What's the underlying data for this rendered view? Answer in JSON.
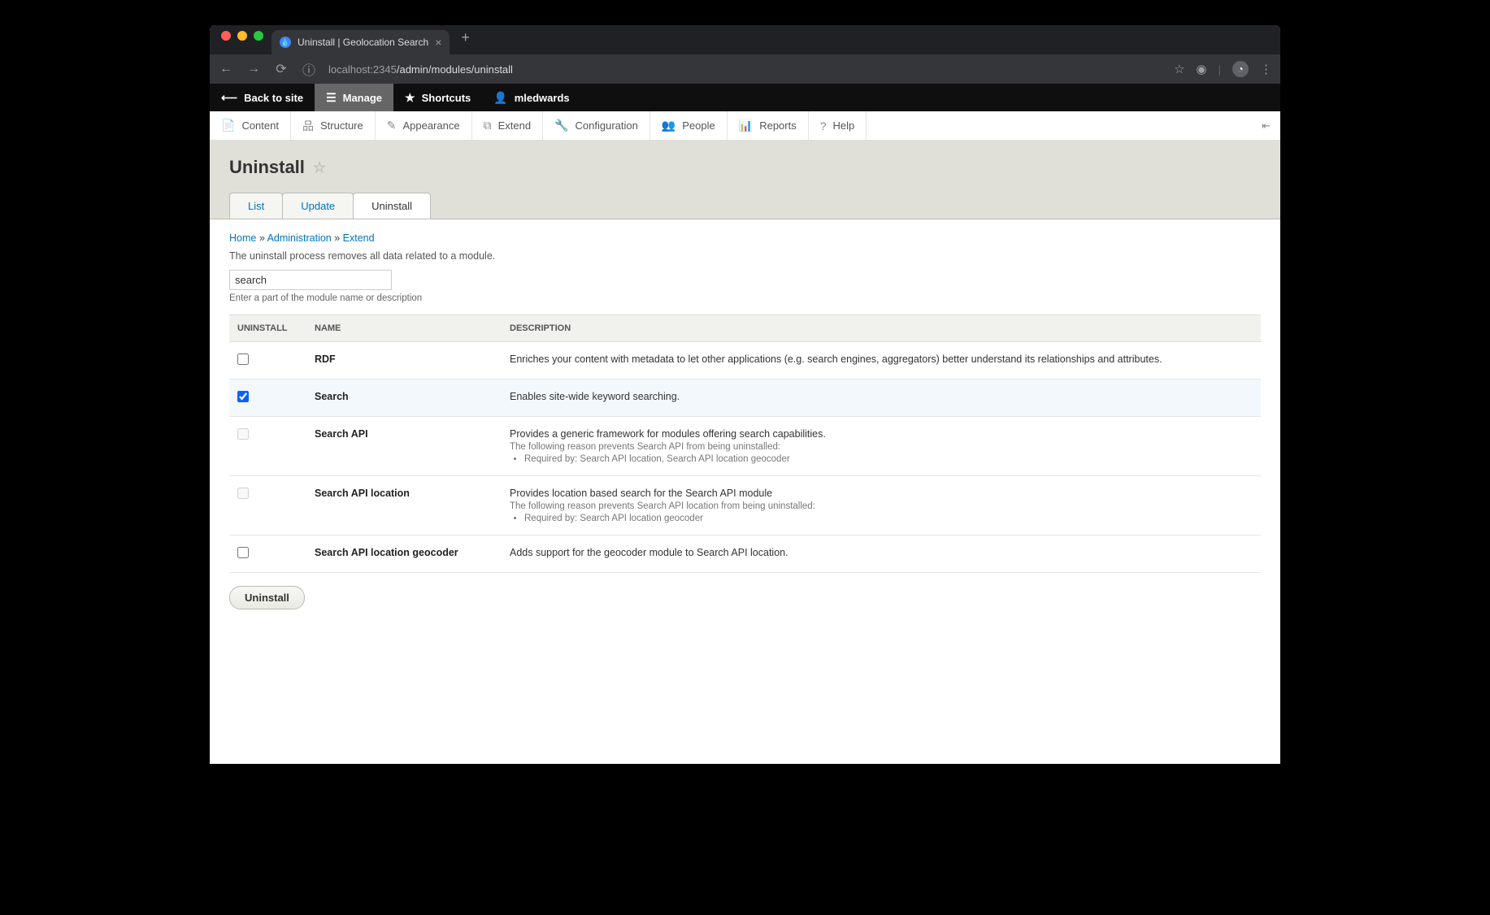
{
  "browser": {
    "tab_title": "Uninstall | Geolocation Search",
    "url_host": "localhost",
    "url_port": ":2345",
    "url_path": "/admin/modules/uninstall"
  },
  "toolbar": {
    "back_to_site": "Back to site",
    "manage": "Manage",
    "shortcuts": "Shortcuts",
    "username": "mledwards",
    "admin_menu": [
      "Content",
      "Structure",
      "Appearance",
      "Extend",
      "Configuration",
      "People",
      "Reports",
      "Help"
    ]
  },
  "page": {
    "title": "Uninstall",
    "tabs": [
      {
        "label": "List",
        "active": false
      },
      {
        "label": "Update",
        "active": false
      },
      {
        "label": "Uninstall",
        "active": true
      }
    ],
    "breadcrumb": {
      "home": "Home",
      "admin": "Administration",
      "extend": "Extend",
      "sep": " » "
    },
    "help_text": "The uninstall process removes all data related to a module.",
    "filter_value": "search",
    "filter_desc": "Enter a part of the module name or description",
    "table": {
      "head_uninstall": "Uninstall",
      "head_name": "Name",
      "head_description": "Description",
      "rows": [
        {
          "checked": false,
          "disabled": false,
          "highlight": false,
          "name": "RDF",
          "desc": "Enriches your content with metadata to let other applications (e.g. search engines, aggregators) better understand its relationships and attributes."
        },
        {
          "checked": true,
          "disabled": false,
          "highlight": true,
          "name": "Search",
          "desc": "Enables site-wide keyword searching."
        },
        {
          "checked": false,
          "disabled": true,
          "highlight": false,
          "name": "Search API",
          "desc": "Provides a generic framework for modules offering search capabilities.",
          "sub": "The following reason prevents Search API from being uninstalled:",
          "bullet": "Required by: Search API location, Search API location geocoder"
        },
        {
          "checked": false,
          "disabled": true,
          "highlight": false,
          "name": "Search API location",
          "desc": "Provides location based search for the Search API module",
          "sub": "The following reason prevents Search API location from being uninstalled:",
          "bullet": "Required by: Search API location geocoder"
        },
        {
          "checked": false,
          "disabled": false,
          "highlight": false,
          "name": "Search API location geocoder",
          "desc": "Adds support for the geocoder module to Search API location."
        }
      ]
    },
    "submit_label": "Uninstall"
  },
  "icons": {
    "content": "📄",
    "structure": "🏗",
    "appearance": "🎨",
    "extend": "🧩",
    "configuration": "🔧",
    "people": "👥",
    "reports": "📊",
    "help": "❓"
  }
}
